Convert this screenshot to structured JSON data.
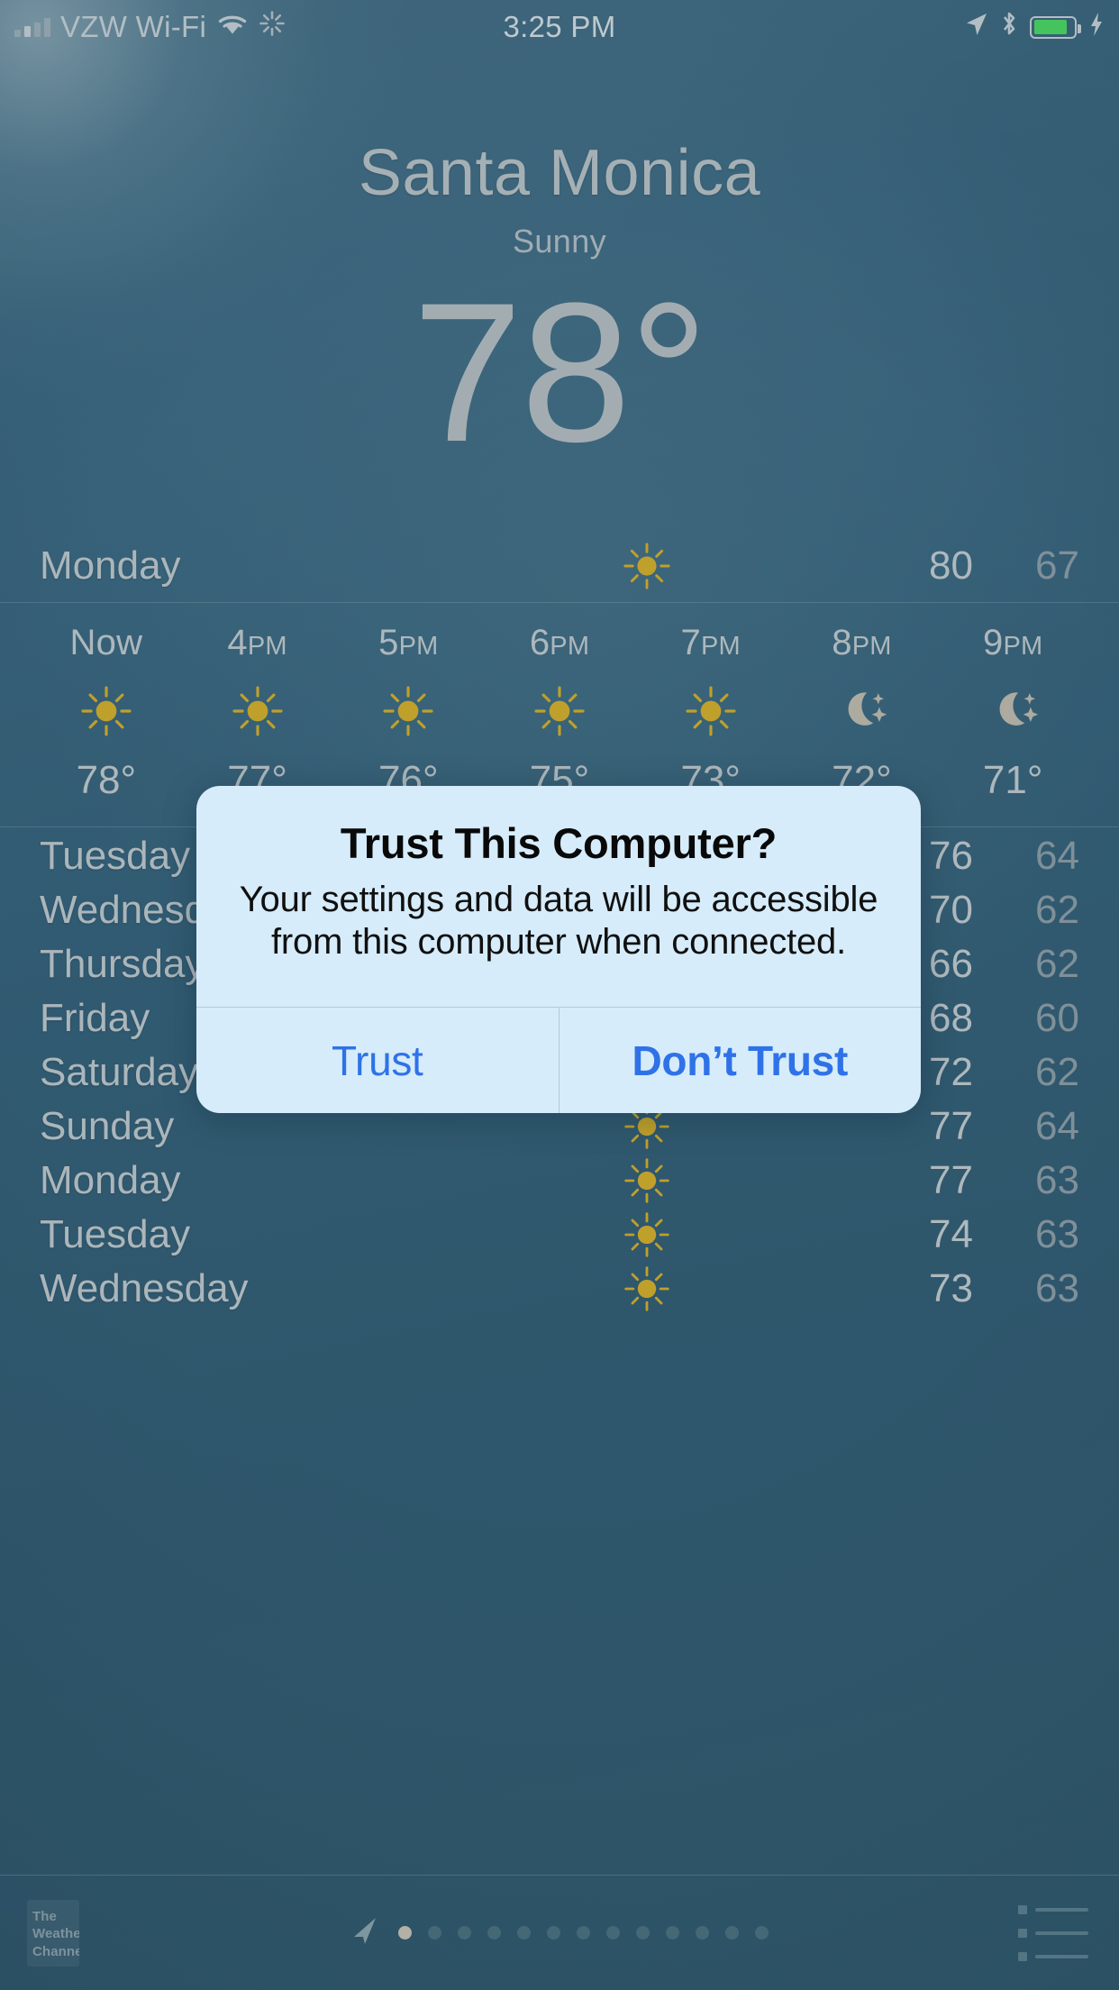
{
  "status_bar": {
    "carrier": "VZW Wi-Fi",
    "signal_icon": "signal-bars-icon",
    "wifi_icon": "wifi-icon",
    "sync_icon": "sync-spinner-icon",
    "time": "3:25 PM",
    "location_icon": "location-arrow-icon",
    "bluetooth_icon": "bluetooth-icon",
    "battery_icon": "battery-icon",
    "charging_icon": "lightning-bolt-icon"
  },
  "hero": {
    "city": "Santa Monica",
    "condition": "Sunny",
    "temperature": "78°"
  },
  "today_row": {
    "day": "Monday",
    "high": "80",
    "low": "67",
    "icon": "sun-icon"
  },
  "hourly": [
    {
      "time": "Now",
      "ampm": "",
      "icon": "sun-icon",
      "temp": "78°"
    },
    {
      "time": "4",
      "ampm": "PM",
      "icon": "sun-icon",
      "temp": "77°"
    },
    {
      "time": "5",
      "ampm": "PM",
      "icon": "sun-icon",
      "temp": "76°"
    },
    {
      "time": "6",
      "ampm": "PM",
      "icon": "sun-icon",
      "temp": "75°"
    },
    {
      "time": "7",
      "ampm": "PM",
      "icon": "sun-icon",
      "temp": "73°"
    },
    {
      "time": "8",
      "ampm": "PM",
      "icon": "moon-stars-icon",
      "temp": "72°"
    },
    {
      "time": "9",
      "ampm": "PM",
      "icon": "moon-stars-icon",
      "temp": "71°"
    }
  ],
  "forecast": [
    {
      "day": "Tuesday",
      "icon": "sun-icon",
      "high": "76",
      "low": "64"
    },
    {
      "day": "Wednesday",
      "icon": "sun-cloud-icon",
      "high": "70",
      "low": "62"
    },
    {
      "day": "Thursday",
      "icon": "sun-cloud-icon",
      "high": "66",
      "low": "62"
    },
    {
      "day": "Friday",
      "icon": "sun-cloud-icon",
      "high": "68",
      "low": "60"
    },
    {
      "day": "Saturday",
      "icon": "sun-icon",
      "high": "72",
      "low": "62"
    },
    {
      "day": "Sunday",
      "icon": "sun-icon",
      "high": "77",
      "low": "64"
    },
    {
      "day": "Monday",
      "icon": "sun-icon",
      "high": "77",
      "low": "63"
    },
    {
      "day": "Tuesday",
      "icon": "sun-icon",
      "high": "74",
      "low": "63"
    },
    {
      "day": "Wednesday",
      "icon": "sun-icon",
      "high": "73",
      "low": "63"
    }
  ],
  "bottom_bar": {
    "logo_line1": "The",
    "logo_line2": "Weather",
    "logo_line3": "Channel",
    "location_icon": "location-arrow-icon",
    "list_icon": "list-icon",
    "page_count": 13,
    "active_page": 1
  },
  "alert": {
    "title": "Trust This Computer?",
    "message": "Your settings and data will be accessible from this computer when connected.",
    "primary_label": "Trust",
    "secondary_label": "Don’t Trust",
    "accent_color": "#2f72e8",
    "background_color": "#d6ecfa"
  },
  "colors": {
    "sky": "#35617a",
    "text": "#c0c9cd",
    "sun": "#d7b02a",
    "cloud": "#b9bdbd",
    "moon": "#c2bbaf"
  }
}
